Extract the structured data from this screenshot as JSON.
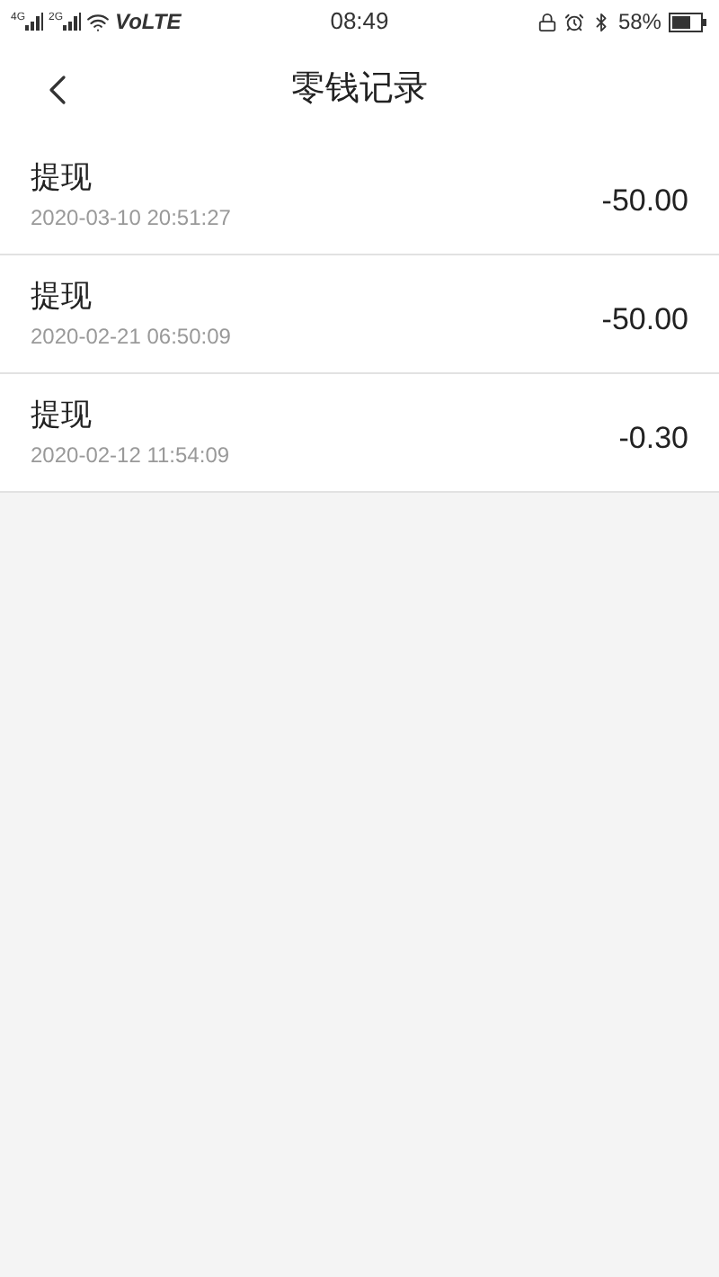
{
  "status_bar": {
    "sim_labels": [
      "4G",
      "2G"
    ],
    "network": "VoLTE",
    "time": "08:49",
    "battery": "58%"
  },
  "header": {
    "title": "零钱记录"
  },
  "records": [
    {
      "title": "提现",
      "time": "2020-03-10 20:51:27",
      "amount": "-50.00"
    },
    {
      "title": "提现",
      "time": "2020-02-21 06:50:09",
      "amount": "-50.00"
    },
    {
      "title": "提现",
      "time": "2020-02-12 11:54:09",
      "amount": "-0.30"
    }
  ]
}
